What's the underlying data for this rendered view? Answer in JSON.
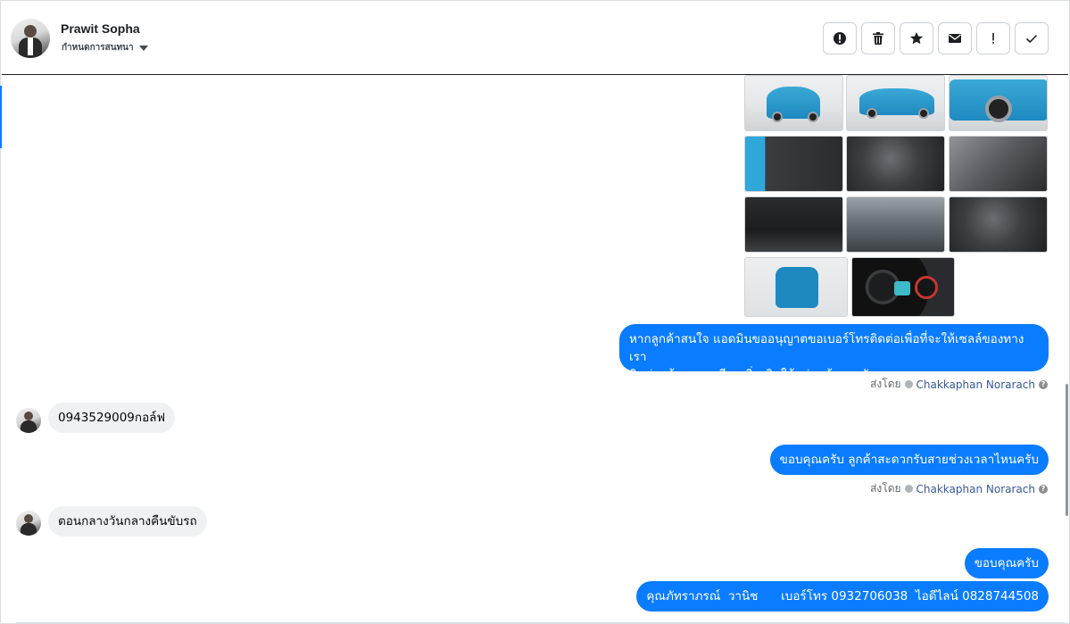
{
  "header": {
    "contact_name": "Prawit Sopha",
    "assign_label": "กำหนดการสนทนา"
  },
  "toolbar": {
    "buttons": [
      {
        "id": "spam",
        "icon": "alert-circle-icon"
      },
      {
        "id": "delete",
        "icon": "trash-icon"
      },
      {
        "id": "star",
        "icon": "star-icon"
      },
      {
        "id": "mark-unread",
        "icon": "envelope-icon"
      },
      {
        "id": "follow-up",
        "icon": "exclamation-icon"
      },
      {
        "id": "done",
        "icon": "checkmark-icon"
      }
    ]
  },
  "photos": {
    "count": 11,
    "subjects": [
      "car-rear",
      "car-side",
      "car-wheel",
      "door-interior",
      "steering-wheel",
      "gear-shift",
      "dashboard",
      "rear-seats",
      "front-seats",
      "open-trunk",
      "instrument-cluster"
    ]
  },
  "messages": [
    {
      "direction": "out",
      "text_lines": [
        "หากลูกค้าสนใจ แอดมินขออนุญาตขอเบอร์โทรติดต่อเพื่อที่จะให้เซลล์ของทางเรา",
        "ติดต่อแจ้งรายละเอียดเพิ่มเติมให้แก่ลูกค้านะครับ"
      ],
      "sent_by_label": "ส่งโดย",
      "sent_by": "Chakkaphan Norarach"
    },
    {
      "direction": "in",
      "text": "0943529009กอล์ฟ"
    },
    {
      "direction": "out",
      "text": "ขอบคุณครับ ลูกค้าสะดวกรับสายช่วงเวลาไหนครับ",
      "sent_by_label": "ส่งโดย",
      "sent_by": "Chakkaphan Norarach"
    },
    {
      "direction": "in",
      "text": "ตอนกลางวันกลางคืนขับรถ"
    },
    {
      "direction": "out",
      "text": "ขอบคุณครับ"
    },
    {
      "direction": "out",
      "text": "คุณภัทราภรณ์  วานิช      เบอร์โทร 0932706038  ไอดีไลน์ 0828744508"
    }
  ],
  "colors": {
    "outgoing_bubble": "#0a7cff",
    "incoming_bubble": "#eff1f3",
    "author_link": "#385898"
  }
}
